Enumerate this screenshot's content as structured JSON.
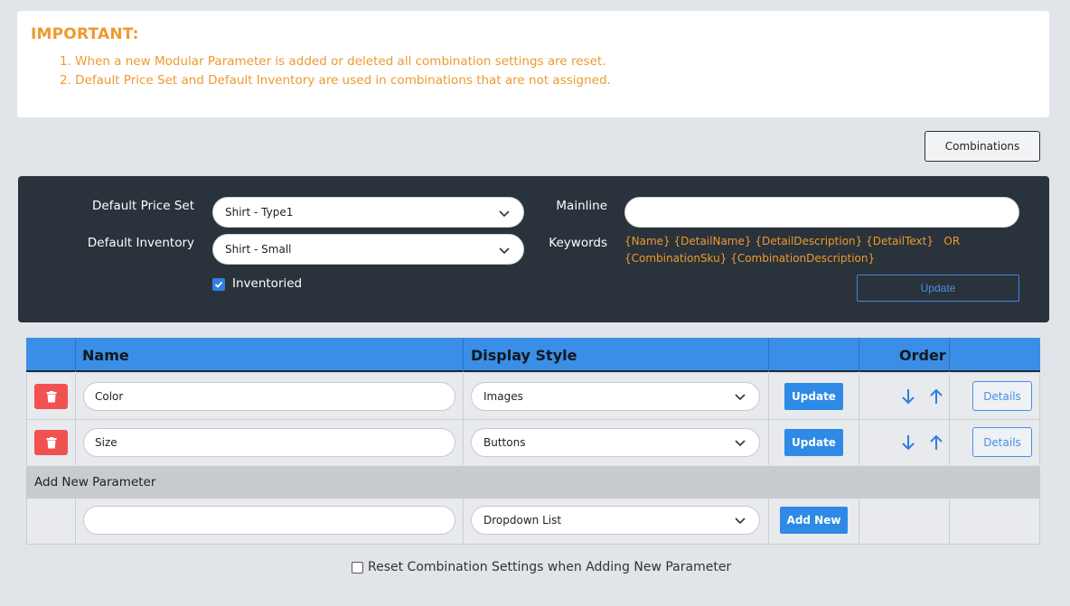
{
  "notice": {
    "title": "IMPORTANT:",
    "items": [
      "1. When a new Modular Parameter is added or deleted all combination settings are reset.",
      "2. Default Price Set and Default Inventory are used in combinations that are not assigned."
    ]
  },
  "toolbar": {
    "combinations_label": "Combinations"
  },
  "settings": {
    "default_price_set_label": "Default Price Set",
    "default_price_set_value": "Shirt - Type1",
    "default_inventory_label": "Default Inventory",
    "default_inventory_value": "Shirt - Small",
    "inventoried_label": "Inventoried",
    "inventoried_checked": true,
    "mainline_label": "Mainline",
    "mainline_value": "",
    "keywords_label": "Keywords",
    "keywords_line1": "{Name} {DetailName} {DetailDescription} {DetailText}   OR",
    "keywords_line2": "{CombinationSku} {CombinationDescription}",
    "update_label": "Update"
  },
  "table": {
    "headers": {
      "name": "Name",
      "display_style": "Display Style",
      "order": "Order"
    },
    "rows": [
      {
        "name": "Color",
        "display_style": "Images",
        "update_label": "Update",
        "details_label": "Details"
      },
      {
        "name": "Size",
        "display_style": "Buttons",
        "update_label": "Update",
        "details_label": "Details"
      }
    ],
    "add_new_section_label": "Add New Parameter",
    "new_row": {
      "name": "",
      "display_style": "Dropdown List",
      "add_label": "Add New"
    }
  },
  "reset_option": {
    "label": "Reset Combination Settings when Adding New Parameter",
    "checked": false
  },
  "colors": {
    "accent": "#3a8ee6",
    "warning": "#ee9a2e",
    "danger": "#f25151",
    "panel": "#2a323b"
  },
  "icons": [
    "trash-icon",
    "arrow-down-icon",
    "arrow-up-icon",
    "chevron-down-icon",
    "check-icon"
  ]
}
